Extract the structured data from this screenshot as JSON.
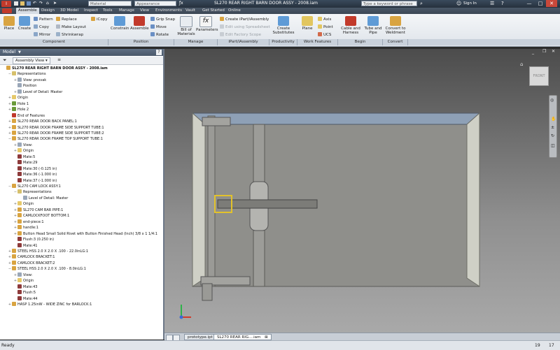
{
  "title_bar": {
    "title": "SL270 REAR RIGHT BARN DOOR ASSY - 2008.iam",
    "material": "Material",
    "appearance": "Appearance",
    "search_placeholder": "Type a keyword or phrase",
    "sign_in": "Sign In"
  },
  "menu": {
    "items": [
      "Assemble",
      "Design",
      "3D Model",
      "Inspect",
      "Tools",
      "Manage",
      "View",
      "Environments",
      "Vault",
      "Get Started",
      "Online"
    ]
  },
  "ribbon": {
    "place": "Place",
    "create": "Create",
    "pattern": "Pattern",
    "copy": "Copy",
    "mirror": "Mirror",
    "replace": "Replace",
    "make_layout": "Make Layout",
    "shrinkwrap": "Shrinkwrap",
    "icopy": "iCopy",
    "constrain": "Constrain",
    "assemble": "Assemble",
    "grip_snap": "Grip Snap",
    "move": "Move",
    "rotate": "Rotate",
    "bill_of_materials": "Bill of Materials",
    "parameters": "Parameters",
    "create_iassembly": "Create iPart/iAssembly",
    "edit_spreadsheet": "Edit using Spreadsheet",
    "edit_factory_scope": "Edit Factory Scope",
    "create_substitutes": "Create Substitutes",
    "plane": "Plane",
    "axis": "Axis",
    "point": "Point",
    "ucs": "UCS",
    "cable_harness": "Cable and Harness",
    "tube_pipe": "Tube and Pipe",
    "convert_weldment": "Convert to Weldment"
  },
  "groups": [
    "Component",
    "Position",
    "Manage",
    "iPart/iAssembly",
    "Productivity",
    "Work Features",
    "Begin",
    "Convert"
  ],
  "panel": {
    "title": "Model",
    "view": "Assembly View",
    "tree": [
      {
        "label": "SL270 REAR RIGHT BARN DOOR ASSY - 2008.iam",
        "indent": 0,
        "toggle": "",
        "color": "#d9a441",
        "bold": true
      },
      {
        "label": "Representations",
        "indent": 1,
        "toggle": "−",
        "color": "#d6c06c"
      },
      {
        "label": "View: pnovak",
        "indent": 2,
        "toggle": "+",
        "color": "#9aa7b8"
      },
      {
        "label": "Position",
        "indent": 2,
        "toggle": "",
        "color": "#9aa7b8"
      },
      {
        "label": "Level of Detail: Master",
        "indent": 2,
        "toggle": "+",
        "color": "#9aa7b8"
      },
      {
        "label": "Origin",
        "indent": 1,
        "toggle": "+",
        "color": "#e6c96b"
      },
      {
        "label": "Hole 1",
        "indent": 1,
        "toggle": "+",
        "color": "#6a9a3a"
      },
      {
        "label": "Hole 2",
        "indent": 1,
        "toggle": "+",
        "color": "#6a9a3a"
      },
      {
        "label": "End of Features",
        "indent": 1,
        "toggle": "",
        "color": "#c0392b"
      },
      {
        "label": "SL270 REAR DOOR BACK PANEL:1",
        "indent": 1,
        "toggle": "+",
        "color": "#d9a441"
      },
      {
        "label": "SL270 REAR DOOR FRAME SIDE SUPPORT TUBE:1",
        "indent": 1,
        "toggle": "+",
        "color": "#d9a441"
      },
      {
        "label": "SL270 REAR DOOR FRAME SIDE SUPPORT TUBE:2",
        "indent": 1,
        "toggle": "+",
        "color": "#d9a441"
      },
      {
        "label": "SL270 REAR DOOR FRAME TOP SUPPORT TUBE:1",
        "indent": 1,
        "toggle": "−",
        "color": "#d9a441"
      },
      {
        "label": "View:",
        "indent": 2,
        "toggle": "+",
        "color": "#9aa7b8"
      },
      {
        "label": "Origin",
        "indent": 2,
        "toggle": "+",
        "color": "#e6c96b"
      },
      {
        "label": "Mate:5",
        "indent": 2,
        "toggle": "",
        "color": "#8e3b3b"
      },
      {
        "label": "Mate:29",
        "indent": 2,
        "toggle": "",
        "color": "#8e3b3b"
      },
      {
        "label": "Mate:30 (-0.125 in)",
        "indent": 2,
        "toggle": "",
        "color": "#8e3b3b"
      },
      {
        "label": "Mate:36 (-1.000 in)",
        "indent": 2,
        "toggle": "",
        "color": "#8e3b3b"
      },
      {
        "label": "Mate:37 (-1.000 in)",
        "indent": 2,
        "toggle": "",
        "color": "#8e3b3b"
      },
      {
        "label": "SL270 CAM LOCK ASSY:1",
        "indent": 1,
        "toggle": "−",
        "color": "#d9a441"
      },
      {
        "label": "Representations",
        "indent": 2,
        "toggle": "−",
        "color": "#d6c06c"
      },
      {
        "label": "Level of Detail: Master",
        "indent": 3,
        "toggle": "",
        "color": "#9aa7b8"
      },
      {
        "label": "Origin",
        "indent": 2,
        "toggle": "+",
        "color": "#e6c96b"
      },
      {
        "label": "SL270 CAM BAR PIPE:1",
        "indent": 2,
        "toggle": "+",
        "color": "#d9a441"
      },
      {
        "label": "CAMLOCKFOOT BOTTOM:1",
        "indent": 2,
        "toggle": "+",
        "color": "#d9a441"
      },
      {
        "label": "end-piece:1",
        "indent": 2,
        "toggle": "+",
        "color": "#d9a441"
      },
      {
        "label": "handle:1",
        "indent": 2,
        "toggle": "+",
        "color": "#d9a441"
      },
      {
        "label": "Button Head Small Solid Rivet with Button Finished Head (Inch) 3/8 x 1 1/4:1",
        "indent": 2,
        "toggle": "+",
        "color": "#d9a441"
      },
      {
        "label": "Flush:3 (0.250 in)",
        "indent": 2,
        "toggle": "",
        "color": "#8e3b3b"
      },
      {
        "label": "Mate:41",
        "indent": 2,
        "toggle": "",
        "color": "#8e3b3b"
      },
      {
        "label": "STEEL HSS 2.0 X 2.0 X .100 - 22.0inLG:1",
        "indent": 1,
        "toggle": "+",
        "color": "#d9a441"
      },
      {
        "label": "CAMLOCK BRACKET:1",
        "indent": 1,
        "toggle": "+",
        "color": "#d9a441"
      },
      {
        "label": "CAMLOCK BRACKET:2",
        "indent": 1,
        "toggle": "+",
        "color": "#d9a441"
      },
      {
        "label": "STEEL HSS 2.0 X 2.0 X .100 - 8.0inLG:1",
        "indent": 1,
        "toggle": "−",
        "color": "#d9a441"
      },
      {
        "label": "View:",
        "indent": 2,
        "toggle": "+",
        "color": "#9aa7b8"
      },
      {
        "label": "Origin",
        "indent": 2,
        "toggle": "+",
        "color": "#e6c96b"
      },
      {
        "label": "Mate:43",
        "indent": 2,
        "toggle": "",
        "color": "#8e3b3b"
      },
      {
        "label": "Flush:5",
        "indent": 2,
        "toggle": "",
        "color": "#8e3b3b"
      },
      {
        "label": "Mate:44",
        "indent": 2,
        "toggle": "",
        "color": "#8e3b3b"
      },
      {
        "label": "HASP 1.25inW - WIDE ZINC for BARLOCK:1",
        "indent": 1,
        "toggle": "+",
        "color": "#d9a441"
      }
    ]
  },
  "viewcube": {
    "face": "FRONT"
  },
  "doc_tabs": [
    "prototype.ipt",
    "SL270 REAR RIG....iam"
  ],
  "status": {
    "left": "Ready",
    "right_a": "19",
    "right_b": "17"
  }
}
